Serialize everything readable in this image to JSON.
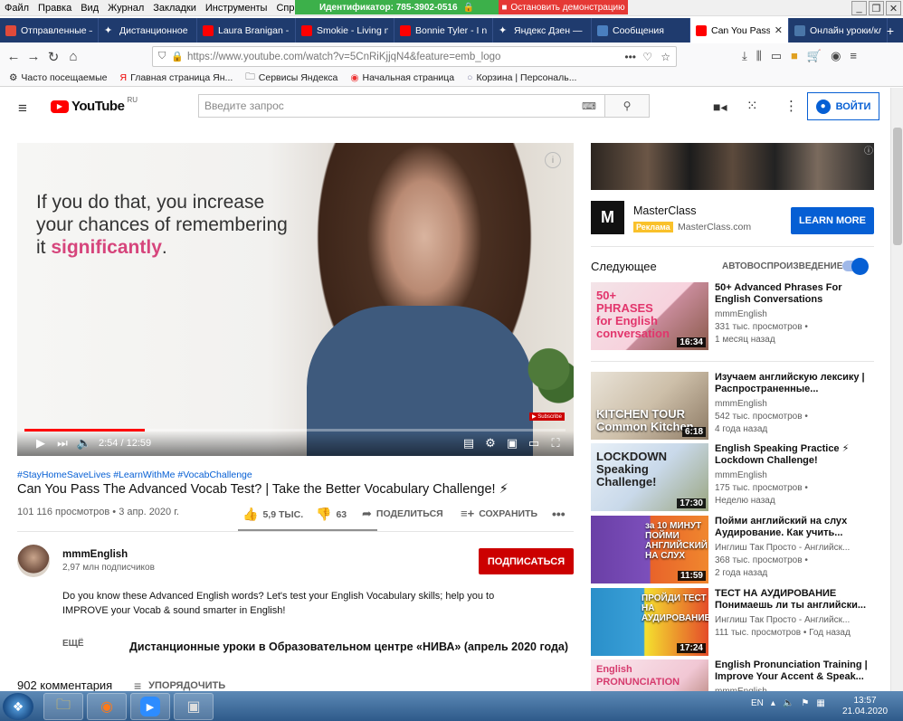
{
  "menubar": {
    "items": [
      "Файл",
      "Правка",
      "Вид",
      "Журнал",
      "Закладки",
      "Инструменты",
      "Справка"
    ],
    "teamviewer_id": "Идентификатор: 785-3902-0516",
    "teamviewer_stop": "Остановить демонстрацию"
  },
  "tabs": [
    {
      "label": "Отправленные —",
      "color": "#e04a3a"
    },
    {
      "label": "Дистанционное С",
      "color": "#ffffff"
    },
    {
      "label": "Laura Branigan - G",
      "color": "#ff0000"
    },
    {
      "label": "Smokie - Living ne",
      "color": "#ff0000"
    },
    {
      "label": "Bonnie Tyler - I ne",
      "color": "#ff0000"
    },
    {
      "label": "Яндекс Дзен — ни",
      "color": "#ffffff"
    },
    {
      "label": "Сообщения",
      "color": "#4a7fbf"
    },
    {
      "label": "Can You Pass",
      "color": "#ff0000",
      "active": true
    },
    {
      "label": "Онлайн уроки/кл",
      "color": "#4a76a8"
    }
  ],
  "nav": {
    "url": "https://www.youtube.com/watch?v=5CnRiKjjqN4&feature=emb_logo"
  },
  "bookmarks": [
    "Часто посещаемые",
    "Главная страница Ян...",
    "Сервисы Яндекса",
    "Начальная страница",
    "Корзина | Персональ..."
  ],
  "yt": {
    "logo": "YouTube",
    "region": "RU",
    "search_placeholder": "Введите запрос",
    "signin": "ВОЙТИ"
  },
  "video": {
    "overlay_line1": "If you do that, you increase",
    "overlay_line2": "your chances of remembering",
    "overlay_line3_prefix": "it ",
    "overlay_highlight": "significantly",
    "overlay_suffix": ".",
    "time": "2:54 / 12:59",
    "progress": 0.223
  },
  "meta": {
    "hashtags": "#StayHomeSaveLives #LearnWithMe #VocabChallenge",
    "title": "Can You Pass The Advanced Vocab Test? | Take the Better Vocabulary Challenge! ⚡",
    "views": "101 116 просмотров • 3 апр. 2020 г.",
    "likes": "5,9 ТЫС.",
    "dislikes": "63",
    "share": "ПОДЕЛИТЬСЯ",
    "save": "СОХРАНИТЬ"
  },
  "channel": {
    "name": "mmmEnglish",
    "subscribers": "2,97 млн подписчиков",
    "subscribe": "ПОДПИСАТЬСЯ",
    "description_line1": "Do you know these Advanced English words? Let's test your English Vocabulary skills; help you to",
    "description_line2": "IMPROVE your Vocab & sound smarter in English!",
    "more": "ЕЩЁ"
  },
  "overlay_caption": "Дистанционные уроки в Образовательном центре «НИВА» (апрель 2020 года)",
  "comments": {
    "count": "902 комментария",
    "sort": "УПОРЯДОЧИТЬ"
  },
  "ad": {
    "name": "MasterClass",
    "badge": "Реклама",
    "domain": "MasterClass.com",
    "cta": "LEARN MORE",
    "logo_letter": "M"
  },
  "sidebar": {
    "next": "Следующее",
    "autoplay": "АВТОВОСПРОИЗВЕДЕНИЕ",
    "items": [
      {
        "title": "50+ Advanced Phrases For English Conversations",
        "channel": "mmmEnglish",
        "views": "331 тыс. просмотров •",
        "date": "1 месяц назад",
        "duration": "16:34",
        "thumb_text": "50+ PHRASES for English conversation"
      },
      {
        "title": "Изучаем английскую лексику | Распространенные...",
        "channel": "mmmEnglish",
        "views": "542 тыс. просмотров •",
        "date": "4 года назад",
        "duration": "6:18",
        "thumb_text": "KITCHEN TOUR Common Kitchen"
      },
      {
        "title": "English Speaking Practice ⚡ Lockdown Challenge!",
        "channel": "mmmEnglish",
        "views": "175 тыс. просмотров •",
        "date": "Неделю назад",
        "duration": "17:30",
        "thumb_text": "LOCKDOWN Speaking Challenge!"
      },
      {
        "title": "Пойми английский на слух Аудирование. Как учить...",
        "channel": "Инглиш Так Просто - Английск...",
        "views": "368 тыс. просмотров •",
        "date": "2 года назад",
        "duration": "11:59",
        "thumb_text": "за 10 МИНУТ ПОЙМИ АНГЛИЙСКИЙ НА СЛУХ"
      },
      {
        "title": "ТЕСТ НА АУДИРОВАНИЕ Понимаешь ли ты английски...",
        "channel": "Инглиш Так Просто - Английск...",
        "views": "111 тыс. просмотров • Год назад",
        "date": "",
        "duration": "17:24",
        "thumb_text": "ПРОЙДИ ТЕСТ НА АУДИРОВАНИЕ"
      },
      {
        "title": "English Pronunciation Training | Improve Your Accent & Speak...",
        "channel": "mmmEnglish",
        "views": "",
        "date": "",
        "duration": "",
        "thumb_text": "English PRONUNCIATION"
      }
    ]
  },
  "taskbar": {
    "lang": "EN",
    "time": "13:57",
    "date": "21.04.2020"
  }
}
